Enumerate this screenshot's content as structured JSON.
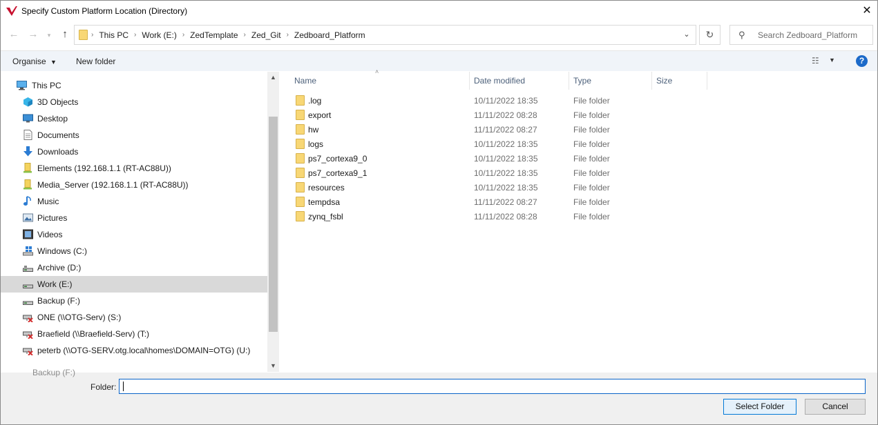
{
  "window": {
    "title": "Specify Custom Platform Location (Directory)"
  },
  "nav": {
    "breadcrumbs": [
      "This PC",
      "Work (E:)",
      "ZedTemplate",
      "Zed_Git",
      "Zedboard_Platform"
    ],
    "search_placeholder": "Search Zedboard_Platform"
  },
  "toolbar": {
    "organise": "Organise",
    "new_folder": "New folder"
  },
  "sidebar": {
    "items": [
      {
        "label": "This PC",
        "icon": "pc-icon"
      },
      {
        "label": "3D Objects",
        "icon": "3d-objects-icon"
      },
      {
        "label": "Desktop",
        "icon": "desktop-icon"
      },
      {
        "label": "Documents",
        "icon": "documents-icon"
      },
      {
        "label": "Downloads",
        "icon": "downloads-icon"
      },
      {
        "label": "Elements (192.168.1.1 (RT-AC88U))",
        "icon": "media-device-icon"
      },
      {
        "label": "Media_Server (192.168.1.1 (RT-AC88U))",
        "icon": "media-device-icon"
      },
      {
        "label": "Music",
        "icon": "music-icon"
      },
      {
        "label": "Pictures",
        "icon": "pictures-icon"
      },
      {
        "label": "Videos",
        "icon": "videos-icon"
      },
      {
        "label": "Windows (C:)",
        "icon": "windows-drive-icon"
      },
      {
        "label": "Archive (D:)",
        "icon": "drive-icon"
      },
      {
        "label": "Work (E:)",
        "icon": "drive-icon"
      },
      {
        "label": "Backup (F:)",
        "icon": "drive-icon"
      },
      {
        "label": "ONE (\\\\OTG-Serv) (S:)",
        "icon": "disconnected-network-drive-icon"
      },
      {
        "label": "Braefield (\\\\Braefield-Serv) (T:)",
        "icon": "disconnected-network-drive-icon"
      },
      {
        "label": "peterb (\\\\OTG-SERV.otg.local\\homes\\DOMAIN=OTG) (U:)",
        "icon": "disconnected-network-drive-icon"
      }
    ],
    "partial_item": "Backup (F:)"
  },
  "file_list": {
    "columns": [
      "Name",
      "Date modified",
      "Type",
      "Size"
    ],
    "rows": [
      {
        "name": ".log",
        "date": "10/11/2022 18:35",
        "type": "File folder"
      },
      {
        "name": "export",
        "date": "11/11/2022 08:28",
        "type": "File folder"
      },
      {
        "name": "hw",
        "date": "11/11/2022 08:27",
        "type": "File folder"
      },
      {
        "name": "logs",
        "date": "10/11/2022 18:35",
        "type": "File folder"
      },
      {
        "name": "ps7_cortexa9_0",
        "date": "10/11/2022 18:35",
        "type": "File folder"
      },
      {
        "name": "ps7_cortexa9_1",
        "date": "10/11/2022 18:35",
        "type": "File folder"
      },
      {
        "name": "resources",
        "date": "10/11/2022 18:35",
        "type": "File folder"
      },
      {
        "name": "tempdsa",
        "date": "11/11/2022 08:27",
        "type": "File folder"
      },
      {
        "name": "zynq_fsbl",
        "date": "11/11/2022 08:28",
        "type": "File folder"
      }
    ]
  },
  "footer": {
    "folder_label": "Folder:",
    "folder_value": "",
    "select_button": "Select Folder",
    "cancel_button": "Cancel"
  },
  "colors": {
    "accent": "#0078d7",
    "folder": "#f8d775",
    "selection": "#d9d9d9",
    "help": "#1c6ac9"
  }
}
